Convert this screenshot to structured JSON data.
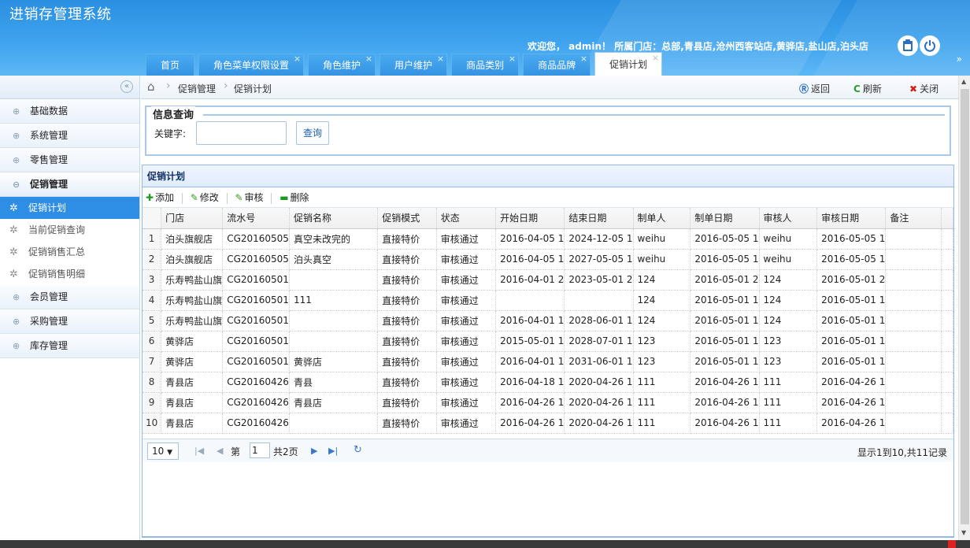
{
  "app": {
    "title": "进销存管理系统"
  },
  "header": {
    "welcome": "欢迎您， admin！ 所属门店：总部,青县店,沧州西客站店,黄骅店,盐山店,泊头店",
    "clipboard_icon": "clipboard-icon",
    "power_icon": "power-icon",
    "collapse_icon": "double-chevron-up-icon"
  },
  "tabs": [
    {
      "label": "首页",
      "closable": false
    },
    {
      "label": "角色菜单权限设置",
      "closable": true
    },
    {
      "label": "角色维护",
      "closable": true
    },
    {
      "label": "用户维护",
      "closable": true
    },
    {
      "label": "商品类别",
      "closable": true
    },
    {
      "label": "商品品牌",
      "closable": true
    },
    {
      "label": "促销计划",
      "closable": true,
      "active": true
    }
  ],
  "sidebar": {
    "groups": [
      {
        "label": "基础数据"
      },
      {
        "label": "系统管理"
      },
      {
        "label": "零售管理"
      },
      {
        "label": "促销管理",
        "open": true
      },
      {
        "label": "会员管理"
      },
      {
        "label": "采购管理"
      },
      {
        "label": "库存管理"
      }
    ],
    "sub_items": [
      {
        "label": "促销计划",
        "active": true
      },
      {
        "label": "当前促销查询"
      },
      {
        "label": "促销销售汇总"
      },
      {
        "label": "促销销售明细"
      }
    ]
  },
  "breadcrumb": {
    "items": [
      "促销管理",
      "促销计划"
    ]
  },
  "actions": {
    "back": "返回",
    "refresh": "刷新",
    "close": "关闭"
  },
  "query": {
    "legend": "信息查询",
    "keyword_label": "关键字:",
    "keyword_value": "",
    "button": "查询"
  },
  "grid": {
    "title": "促销计划",
    "toolbar": {
      "add": "添加",
      "edit": "修改",
      "audit": "审核",
      "delete": "删除"
    },
    "columns": [
      "门店",
      "流水号",
      "促销名称",
      "促销模式",
      "状态",
      "开始日期",
      "结束日期",
      "制单人",
      "制单日期",
      "审核人",
      "审核日期",
      "备注"
    ],
    "rows": [
      [
        "1",
        "泊头旗舰店",
        "CG20160505",
        "真空未改完的",
        "直接特价",
        "审核通过",
        "2016-04-05 1",
        "2024-12-05 1",
        "weihu",
        "2016-05-05 1",
        "weihu",
        "2016-05-05 1",
        ""
      ],
      [
        "2",
        "泊头旗舰店",
        "CG20160505",
        "泊头真空",
        "直接特价",
        "审核通过",
        "2016-04-05 1",
        "2027-05-05 1",
        "weihu",
        "2016-05-05 1",
        "weihu",
        "2016-05-05 1",
        ""
      ],
      [
        "3",
        "乐寿鸭盐山旗",
        "CG20160501",
        "",
        "直接特价",
        "审核通过",
        "2016-04-01 2",
        "2023-05-01 2",
        "124",
        "2016-05-01 2",
        "124",
        "2016-05-01 2",
        ""
      ],
      [
        "4",
        "乐寿鸭盐山旗",
        "CG20160501",
        "111",
        "直接特价",
        "审核通过",
        "",
        "",
        "124",
        "2016-05-01 1",
        "124",
        "2016-05-01 1",
        ""
      ],
      [
        "5",
        "乐寿鸭盐山旗",
        "CG20160501",
        "",
        "直接特价",
        "审核通过",
        "2016-04-01 1",
        "2028-06-01 1",
        "124",
        "2016-05-01 1",
        "124",
        "2016-05-01 1",
        ""
      ],
      [
        "6",
        "黄骅店",
        "CG20160501",
        "",
        "直接特价",
        "审核通过",
        "2015-05-01 1",
        "2028-07-01 1",
        "123",
        "2016-05-01 1",
        "123",
        "2016-05-01 1",
        ""
      ],
      [
        "7",
        "黄骅店",
        "CG20160501",
        "黄骅店",
        "直接特价",
        "审核通过",
        "2016-04-01 1",
        "2031-06-01 1",
        "123",
        "2016-05-01 1",
        "123",
        "2016-05-01 1",
        ""
      ],
      [
        "8",
        "青县店",
        "CG20160426",
        "青县",
        "直接特价",
        "审核通过",
        "2016-04-18 1",
        "2020-04-26 1",
        "111",
        "2016-04-26 1",
        "111",
        "2016-04-26 1",
        ""
      ],
      [
        "9",
        "青县店",
        "CG20160426",
        "青县店",
        "直接特价",
        "审核通过",
        "2016-04-26 1",
        "2020-04-26 1",
        "111",
        "2016-04-26 1",
        "111",
        "2016-04-26 1",
        ""
      ],
      [
        "10",
        "青县店",
        "CG20160426",
        "",
        "直接特价",
        "审核通过",
        "2016-04-26 1",
        "2020-04-26 1",
        "111",
        "2016-04-26 1",
        "111",
        "2016-04-26 1",
        ""
      ]
    ]
  },
  "pager": {
    "page_size": "10",
    "page_prefix": "第",
    "page_value": "1",
    "total_pages": "共2页",
    "record_info": "显示1到10,共11记录"
  }
}
